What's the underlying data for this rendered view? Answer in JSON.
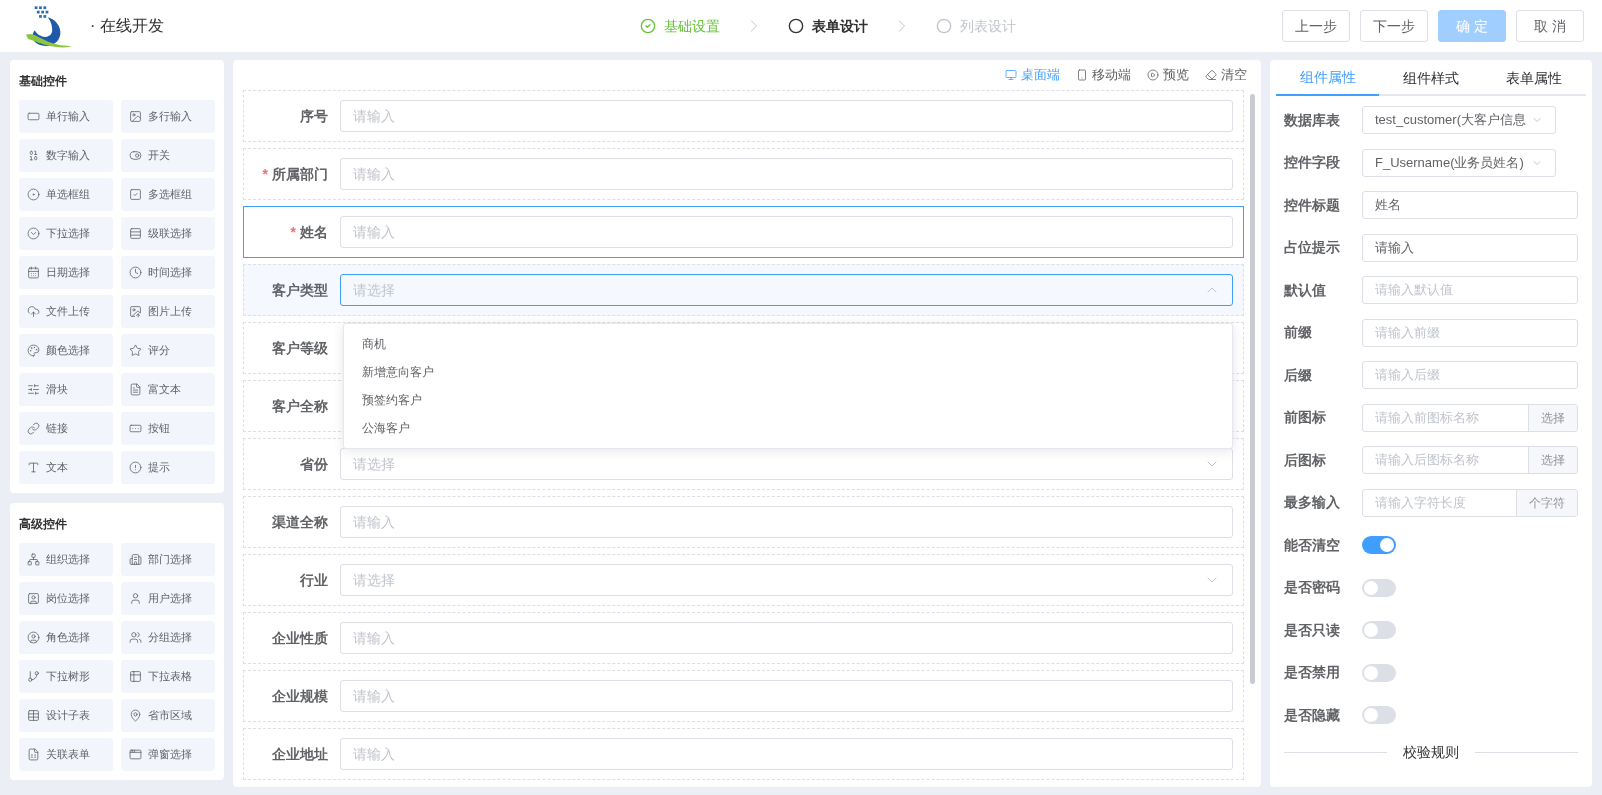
{
  "header": {
    "app_title": "· 在线开发",
    "steps": [
      {
        "label": "基础设置",
        "completed": true,
        "selected": false
      },
      {
        "label": "表单设计",
        "completed": false,
        "selected": true
      },
      {
        "label": "列表设计",
        "completed": false,
        "selected": false
      }
    ],
    "buttons": [
      {
        "label": "上一步",
        "kind": "default",
        "disabled": false
      },
      {
        "label": "下一步",
        "kind": "default",
        "disabled": false
      },
      {
        "label": "确 定",
        "kind": "primary",
        "disabled": true
      },
      {
        "label": "取 消",
        "kind": "default",
        "disabled": false
      }
    ]
  },
  "palette": [
    {
      "title": "基础控件",
      "items": [
        "单行输入",
        "多行输入",
        "数字输入",
        "开关",
        "单选框组",
        "多选框组",
        "下拉选择",
        "级联选择",
        "日期选择",
        "时间选择",
        "文件上传",
        "图片上传",
        "颜色选择",
        "评分",
        "滑块",
        "富文本",
        "链接",
        "按钮",
        "文本",
        "提示"
      ]
    },
    {
      "title": "高级控件",
      "items": [
        "组织选择",
        "部门选择",
        "岗位选择",
        "用户选择",
        "角色选择",
        "分组选择",
        "下拉树形",
        "下拉表格",
        "设计子表",
        "省市区域",
        "关联表单",
        "弹窗选择"
      ]
    }
  ],
  "canvas": {
    "toolbar": [
      {
        "label": "桌面端",
        "selected": true
      },
      {
        "label": "移动端",
        "selected": false
      },
      {
        "label": "预览",
        "selected": false
      },
      {
        "label": "清空",
        "selected": false
      }
    ],
    "fields": [
      {
        "label": "序号",
        "kind": "input",
        "selected": false,
        "placeholder": "请输入"
      },
      {
        "label": "所属部门",
        "kind": "input",
        "required_mark": "*",
        "selected": false,
        "placeholder": "请输入"
      },
      {
        "label": "姓名",
        "kind": "input",
        "required_mark": "*",
        "selected": true,
        "placeholder": "请输入"
      },
      {
        "label": "客户类型",
        "kind": "select",
        "selected": false,
        "expanded": true,
        "placeholder": "请选择",
        "options": [
          "商机",
          "新增意向客户",
          "预签约客户",
          "公海客户"
        ]
      },
      {
        "label": "客户等级",
        "kind": "covered",
        "selected": false
      },
      {
        "label": "客户全称",
        "kind": "covered",
        "selected": false
      },
      {
        "label": "省份",
        "kind": "select",
        "selected": false,
        "expanded": false,
        "placeholder": "请选择"
      },
      {
        "label": "渠道全称",
        "kind": "input",
        "selected": false,
        "placeholder": "请输入"
      },
      {
        "label": "行业",
        "kind": "select",
        "selected": false,
        "expanded": false,
        "placeholder": "请选择"
      },
      {
        "label": "企业性质",
        "kind": "input",
        "selected": false,
        "placeholder": "请输入"
      },
      {
        "label": "企业规模",
        "kind": "input",
        "selected": false,
        "placeholder": "请输入"
      },
      {
        "label": "企业地址",
        "kind": "input",
        "selected": false,
        "placeholder": "请输入"
      }
    ]
  },
  "properties": {
    "tabs": [
      {
        "label": "组件属性",
        "selected": true
      },
      {
        "label": "组件样式",
        "selected": false
      },
      {
        "label": "表单属性",
        "selected": false
      }
    ],
    "rows": [
      {
        "label": "数据库表",
        "kind": "select",
        "value": "test_customer(大客户信息"
      },
      {
        "label": "控件字段",
        "kind": "select",
        "value": "F_Username(业务员姓名)"
      },
      {
        "label": "控件标题",
        "kind": "input",
        "value": "姓名"
      },
      {
        "label": "占位提示",
        "kind": "input",
        "value": "请输入"
      },
      {
        "label": "默认值",
        "kind": "input",
        "placeholder": "请输入默认值"
      },
      {
        "label": "前缀",
        "kind": "input",
        "placeholder": "请输入前缀"
      },
      {
        "label": "后缀",
        "kind": "input",
        "placeholder": "请输入后缀"
      },
      {
        "label": "前图标",
        "kind": "append",
        "placeholder": "请输入前图标名称",
        "append": "选择"
      },
      {
        "label": "后图标",
        "kind": "append",
        "placeholder": "请输入后图标名称",
        "append": "选择"
      },
      {
        "label": "最多输入",
        "kind": "append",
        "placeholder": "请输入字符长度",
        "append": "个字符"
      },
      {
        "label": "能否清空",
        "kind": "switch",
        "on": true
      },
      {
        "label": "是否密码",
        "kind": "switch",
        "on": false
      },
      {
        "label": "是否只读",
        "kind": "switch",
        "on": false
      },
      {
        "label": "是否禁用",
        "kind": "switch",
        "on": false
      },
      {
        "label": "是否隐藏",
        "kind": "switch",
        "on": false
      }
    ],
    "divider": "校验规则"
  }
}
